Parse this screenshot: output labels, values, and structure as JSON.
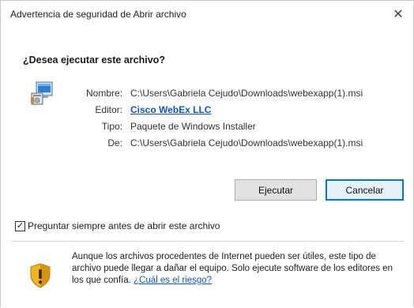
{
  "window": {
    "title": "Advertencia de seguridad de Abrir archivo",
    "close_glyph": "✕"
  },
  "question": "¿Desea ejecutar este archivo?",
  "icons": {
    "file_icon": "installer-package-icon",
    "warning_icon": "shield-warning-icon"
  },
  "fields": {
    "name_label": "Nombre:",
    "name_value": "C:\\Users\\Gabriela Cejudo\\Downloads\\webexapp(1).msi",
    "publisher_label": "Editor:",
    "publisher_value": "Cisco WebEx LLC",
    "type_label": "Tipo:",
    "type_value": "Paquete de Windows Installer",
    "from_label": "De:",
    "from_value": "C:\\Users\\Gabriela Cejudo\\Downloads\\webexapp(1).msi"
  },
  "buttons": {
    "run_label": "Ejecutar",
    "cancel_label": "Cancelar"
  },
  "checkbox": {
    "checked": true,
    "check_glyph": "✓",
    "label": "Preguntar siempre antes de abrir este archivo"
  },
  "warning": {
    "text": "Aunque los archivos procedentes de Internet pueden ser útiles, este tipo de archivo puede llegar a dañar el equipo. Solo ejecute software de los editores en los que confía. ",
    "link_text": "¿Cuál es el riesgo?"
  },
  "colors": {
    "link": "#0b57c9",
    "focus_border": "#0078d7"
  }
}
